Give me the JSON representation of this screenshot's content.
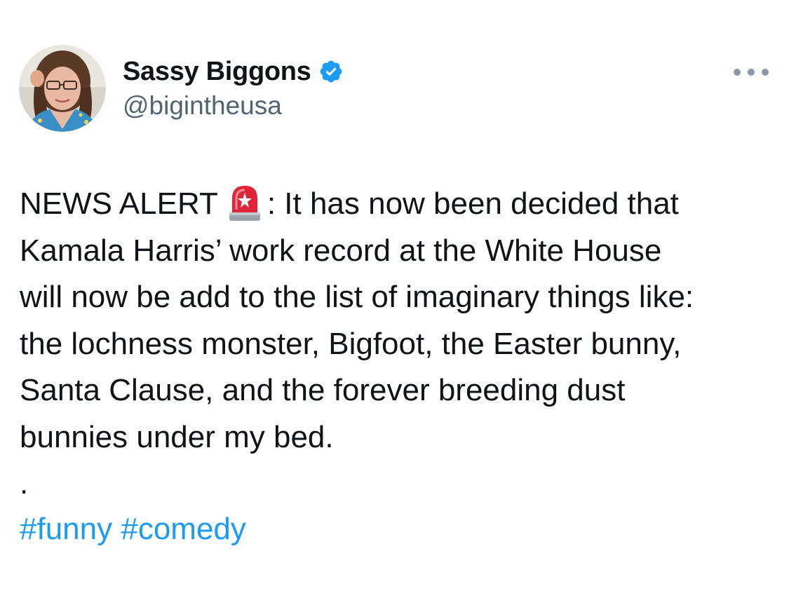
{
  "author": {
    "display_name": "Sassy Biggons",
    "handle": "@bigintheusa",
    "verified": true
  },
  "tweet": {
    "lines": [
      "NEWS ALERT",
      ": It has now been decided that",
      "Kamala Harris’ work record at the White House",
      "will now be add to the list of imaginary things like:",
      "the lochness monster, Bigfoot, the Easter bunny,",
      "Santa Clause, and the forever breeding dust",
      "bunnies under my bed.",
      "."
    ],
    "emoji": "siren-icon",
    "hashtags": [
      "#funny",
      "#comedy"
    ]
  },
  "colors": {
    "text": "#0f1419",
    "secondary": "#536471",
    "link": "#1d9bf0",
    "verified": "#1d9bf0"
  }
}
